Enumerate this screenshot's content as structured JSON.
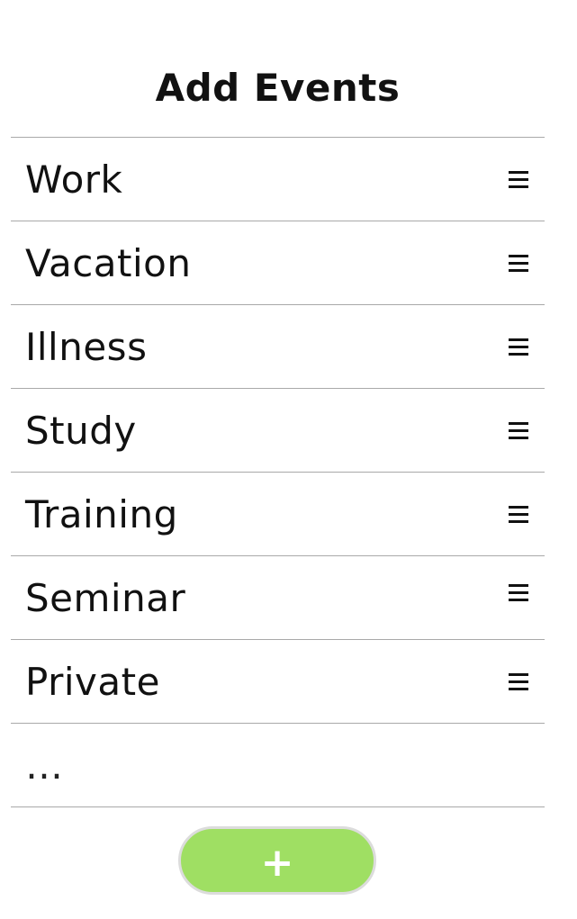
{
  "header": {
    "title": "Add Events"
  },
  "events": [
    {
      "label": "Work",
      "icon": "drag-handle-icon"
    },
    {
      "label": "Vacation",
      "icon": "drag-handle-icon"
    },
    {
      "label": "Illness",
      "icon": "drag-handle-icon"
    },
    {
      "label": "Study",
      "icon": "drag-handle-icon"
    },
    {
      "label": "Training",
      "icon": "drag-handle-icon"
    },
    {
      "label": "Seminar",
      "icon": "drag-handle-icon"
    },
    {
      "label": "Private",
      "icon": "drag-handle-icon"
    }
  ],
  "placeholder": {
    "label": "…"
  },
  "add_button": {
    "label": "+",
    "color": "#9fdf63"
  }
}
